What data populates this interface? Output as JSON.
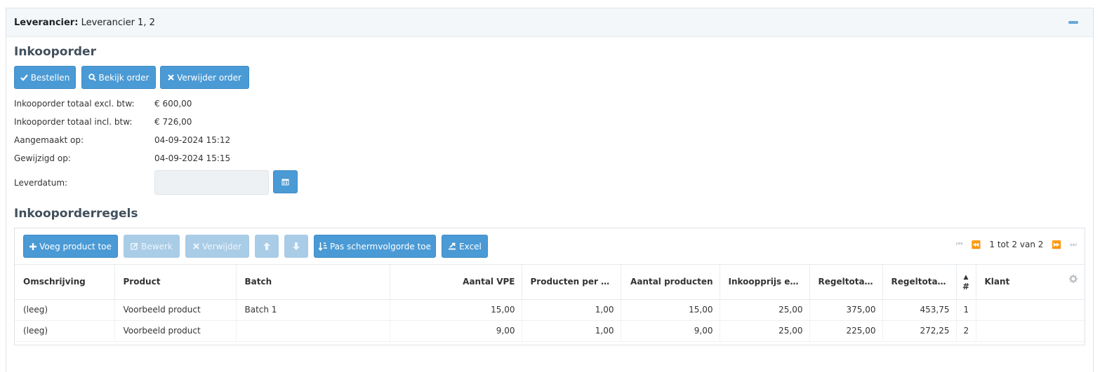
{
  "panel": {
    "title_label": "Leverancier:",
    "title_value": "Leverancier 1, 2"
  },
  "order": {
    "section_title": "Inkooporder",
    "buttons": {
      "order": "Bestellen",
      "view": "Bekijk order",
      "delete": "Verwijder order"
    },
    "fields": [
      {
        "label": "Inkooporder totaal excl. btw:",
        "value": "€ 600,00"
      },
      {
        "label": "Inkooporder totaal incl. btw:",
        "value": "€ 726,00"
      },
      {
        "label": "Aangemaakt op:",
        "value": "04-09-2024 15:12"
      },
      {
        "label": "Gewijzigd op:",
        "value": "04-09-2024 15:15"
      }
    ],
    "delivery_label": "Leverdatum:",
    "delivery_value": ""
  },
  "lines": {
    "section_title": "Inkooporderregels",
    "toolbar": {
      "add": "Voeg product toe",
      "edit": "Bewerk",
      "delete": "Verwijder",
      "reorder": "Pas schermvolgorde toe",
      "excel": "Excel"
    },
    "pager_text": "1 tot 2 van 2",
    "columns": [
      "Omschrijving",
      "Product",
      "Batch",
      "Aantal VPE",
      "Producten per VPE",
      "Aantal producten",
      "Inkoopprijs excl...",
      "Regeltotaal ...",
      "Regeltotaal ...",
      "#",
      "Klant"
    ],
    "rows": [
      [
        "(leeg)",
        "Voorbeeld product",
        "Batch 1",
        "15,00",
        "1,00",
        "15,00",
        "25,00",
        "375,00",
        "453,75",
        "1",
        ""
      ],
      [
        "(leeg)",
        "Voorbeeld product",
        "",
        "9,00",
        "1,00",
        "9,00",
        "25,00",
        "225,00",
        "272,25",
        "2",
        ""
      ]
    ]
  },
  "colors": {
    "primary": "#4a9ad5",
    "primary_disabled": "#a9cce7",
    "header_bg": "#f3f7fa"
  }
}
